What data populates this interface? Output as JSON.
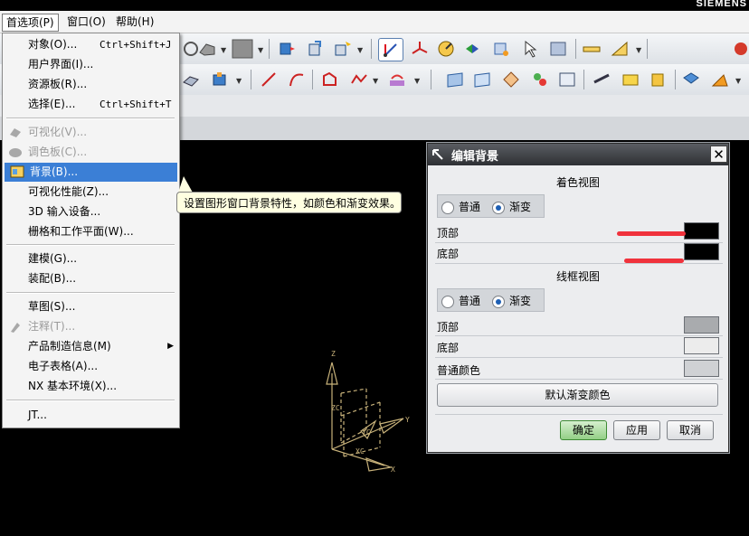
{
  "app": {
    "brand": "SIEMENS"
  },
  "menubar": {
    "items": [
      {
        "label": "首选项(P)"
      },
      {
        "label": "窗口(O)"
      },
      {
        "label": "帮助(H)"
      }
    ]
  },
  "dropdown": {
    "items": [
      {
        "label": "对象(O)...",
        "shortcut": "Ctrl+Shift+J",
        "icon": "object-icon"
      },
      {
        "label": "用户界面(I)...",
        "shortcut": "",
        "icon": ""
      },
      {
        "label": "资源板(R)...",
        "shortcut": "",
        "icon": ""
      },
      {
        "label": "选择(E)...",
        "shortcut": "Ctrl+Shift+T",
        "icon": ""
      },
      {
        "label": "可视化(V)...",
        "shortcut": "",
        "icon": "visualization-icon",
        "disabled": true
      },
      {
        "label": "调色板(C)...",
        "shortcut": "",
        "icon": "palette-icon",
        "disabled": true
      },
      {
        "label": "背景(B)...",
        "shortcut": "",
        "icon": "background-icon",
        "selected": true
      },
      {
        "label": "可视化性能(Z)...",
        "shortcut": "",
        "icon": ""
      },
      {
        "label": "3D 输入设备...",
        "shortcut": "",
        "icon": ""
      },
      {
        "label": "栅格和工作平面(W)...",
        "shortcut": "",
        "icon": ""
      },
      {
        "label": "建模(G)...",
        "shortcut": "",
        "icon": ""
      },
      {
        "label": "装配(B)...",
        "shortcut": "",
        "icon": ""
      },
      {
        "label": "草图(S)...",
        "shortcut": "",
        "icon": ""
      },
      {
        "label": "注释(T)...",
        "shortcut": "",
        "icon": "annotation-icon",
        "disabled": true
      },
      {
        "label": "产品制造信息(M)",
        "shortcut": "",
        "icon": "",
        "submenu": true
      },
      {
        "label": "电子表格(A)...",
        "shortcut": "",
        "icon": ""
      },
      {
        "label": "NX 基本环境(X)...",
        "shortcut": "",
        "icon": ""
      },
      {
        "label": "JT...",
        "shortcut": "",
        "icon": ""
      }
    ]
  },
  "tooltip": {
    "text": "设置图形窗口背景特性，如颜色和渐变效果。"
  },
  "dialog": {
    "title": "编辑背景",
    "close_label": "✕",
    "shaded": {
      "title": "着色视图",
      "radio_plain": "普通",
      "radio_gradient": "渐变",
      "selected": "渐变",
      "top_label": "顶部",
      "bottom_label": "底部",
      "top_color": "#000000",
      "bottom_color": "#000000"
    },
    "wireframe": {
      "title": "线框视图",
      "radio_plain": "普通",
      "radio_gradient": "渐变",
      "selected": "渐变",
      "top_label": "顶部",
      "bottom_label": "底部",
      "top_color": "#a9abae",
      "bottom_color": "#ececec"
    },
    "plain_color_label": "普通颜色",
    "plain_color": "#cfd1d4",
    "default_gradient_button": "默认渐变颜色",
    "ok_button": "确定",
    "apply_button": "应用",
    "cancel_button": "取消"
  },
  "graphics": {
    "axis_labels": {
      "z": "Z",
      "y": "Y",
      "x": "X",
      "zc": "ZC",
      "yc": "YC",
      "xc": "XC"
    }
  }
}
